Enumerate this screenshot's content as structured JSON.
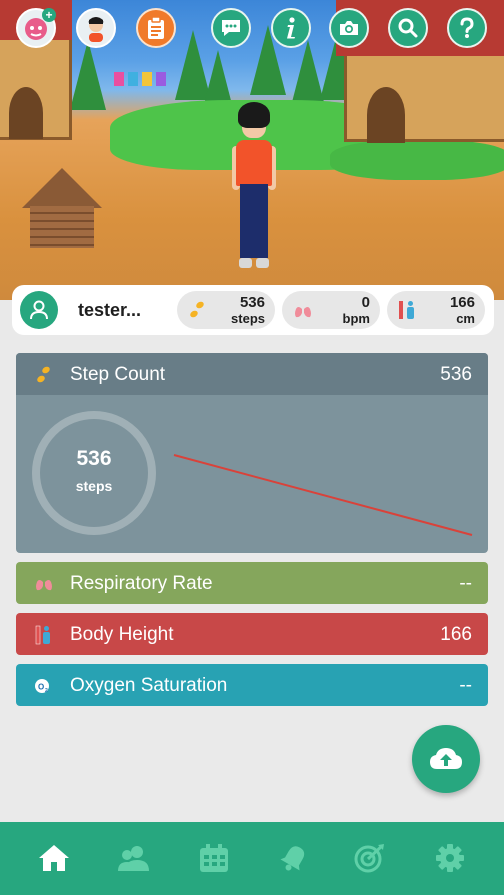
{
  "topbar": {
    "icons": [
      "add-friend-avatar-icon",
      "profile-avatar-icon",
      "clipboard-icon",
      "chat-icon",
      "info-icon",
      "camera-icon",
      "search-icon",
      "help-icon"
    ]
  },
  "user": {
    "name": "tester..."
  },
  "summary": {
    "steps": {
      "value": "536",
      "unit": "steps",
      "color": "#f5b324"
    },
    "heart_rate": {
      "value": "0",
      "unit": "bpm",
      "color": "#f08c9a"
    },
    "height": {
      "value": "166",
      "unit": "cm",
      "color": "#e05050"
    }
  },
  "metrics": {
    "step_count": {
      "label": "Step Count",
      "value": "536",
      "ring_value": "536",
      "ring_unit": "steps",
      "color": "#7d939c"
    },
    "respiratory_rate": {
      "label": "Respiratory Rate",
      "value": "--",
      "color": "#85a65c"
    },
    "body_height": {
      "label": "Body Height",
      "value": "166",
      "color": "#c84848"
    },
    "oxygen_saturation": {
      "label": "Oxygen Saturation",
      "value": "--",
      "color": "#28a2b3"
    }
  },
  "colors": {
    "accent": "#27a77f",
    "trend_line": "#d9423a"
  },
  "bottom_nav": {
    "items": [
      "home-icon",
      "friends-icon",
      "calendar-icon",
      "bell-icon",
      "target-icon",
      "settings-icon"
    ],
    "active": "home-icon"
  }
}
